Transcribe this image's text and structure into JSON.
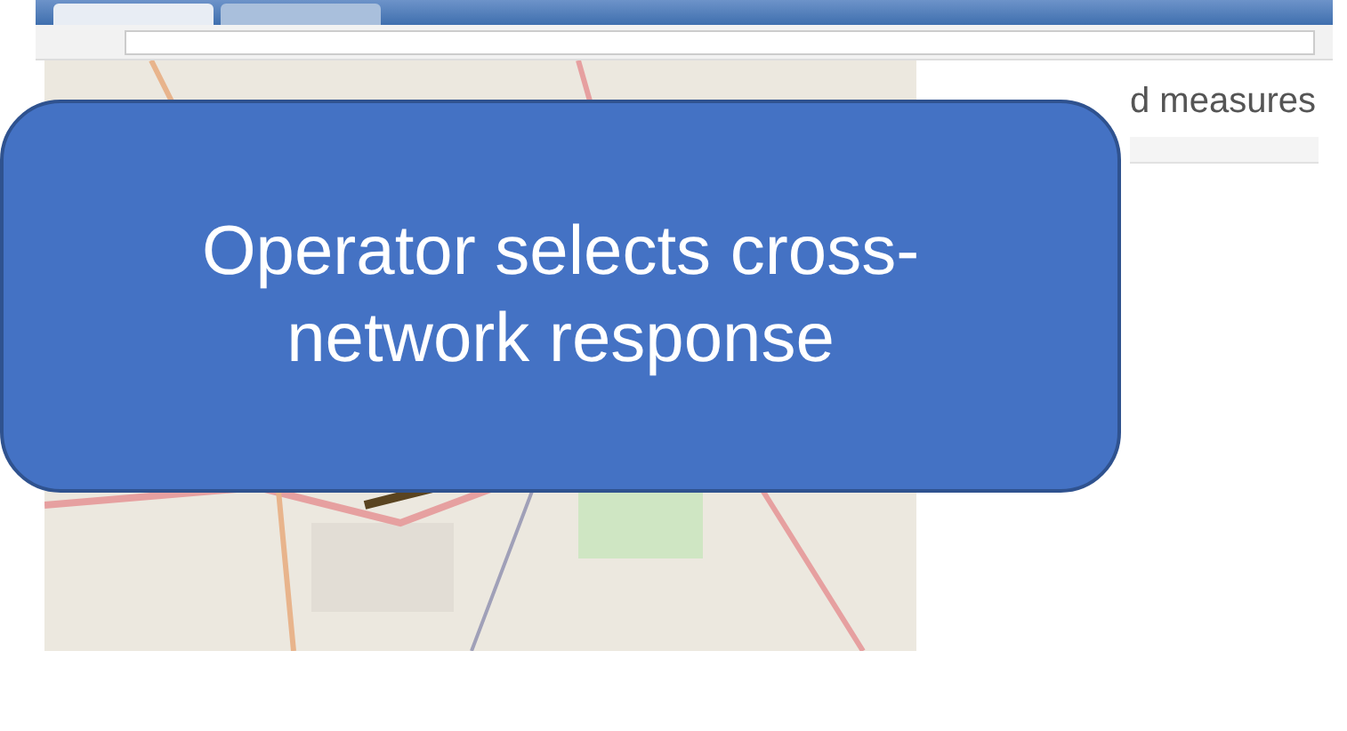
{
  "panel": {
    "heading": "d measures"
  },
  "callout": {
    "text": "Operator selects cross-network response"
  }
}
